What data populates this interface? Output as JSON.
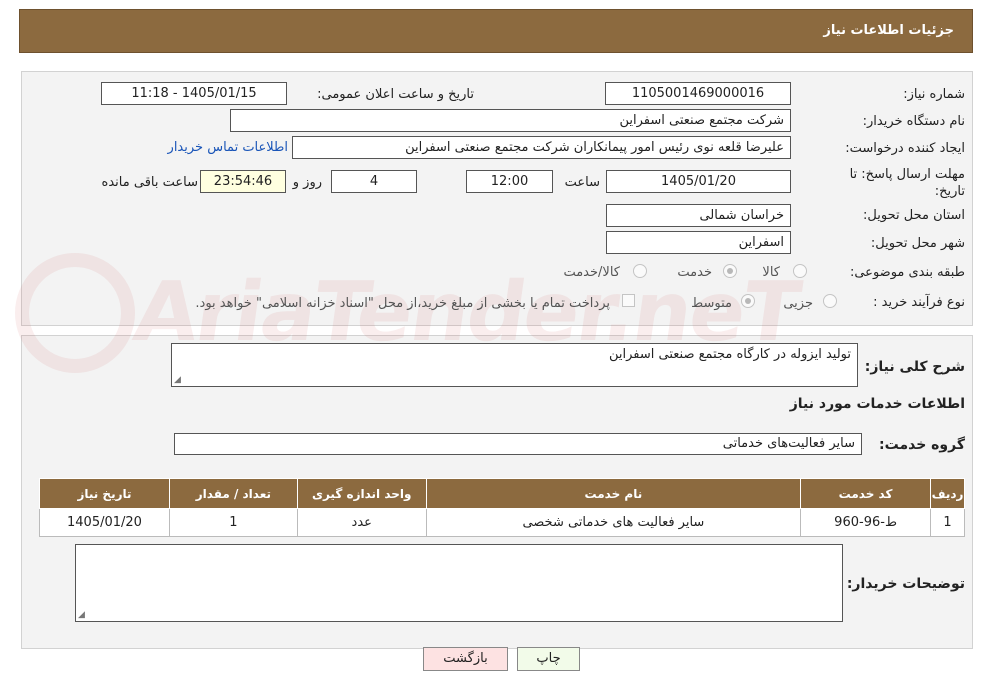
{
  "header": {
    "title": "جزئیات اطلاعات نیاز"
  },
  "form": {
    "need_number_label": "شماره نیاز:",
    "need_number_value": "1105001469000016",
    "announce_datetime_label": "تاریخ و ساعت اعلان عمومی:",
    "announce_datetime_value": "1405/01/15 - 11:18",
    "buyer_org_label": "نام دستگاه خریدار:",
    "buyer_org_value": "شرکت مجتمع صنعتی اسفراین",
    "requester_label": "ایجاد کننده درخواست:",
    "requester_value": "علیرضا قلعه نوی رئیس امور پیمانکاران شرکت مجتمع صنعتی اسفراین",
    "buyer_contact_link": "اطلاعات تماس خریدار",
    "deadline_label": "مهلت ارسال پاسخ: تا تاریخ:",
    "deadline_date": "1405/01/20",
    "time_label": "ساعت",
    "deadline_time": "12:00",
    "days_value": "4",
    "days_label": "روز و",
    "remaining_time": "23:54:46",
    "remaining_label": "ساعت باقی مانده",
    "province_label": "استان محل تحویل:",
    "province_value": "خراسان شمالی",
    "city_label": "شهر محل تحویل:",
    "city_value": "اسفراین",
    "category_label": "طبقه بندی موضوعی:",
    "category_options": [
      "کالا",
      "خدمت",
      "کالا/خدمت"
    ],
    "category_selected": "خدمت",
    "purchase_type_label": "نوع فرآیند خرید :",
    "purchase_options": [
      "جزیی",
      "متوسط"
    ],
    "purchase_selected": "متوسط",
    "treasury_note": "پرداخت تمام یا بخشی از مبلغ خرید،از محل \"اسناد خزانه اسلامی\" خواهد بود."
  },
  "details": {
    "summary_label": "شرح کلی نیاز:",
    "summary_value": "تولید ایزوله در کارگاه مجتمع صنعتی اسفراین",
    "services_heading": "اطلاعات خدمات مورد نیاز",
    "service_group_label": "گروه خدمت:",
    "service_group_value": "سایر فعالیت‌های خدماتی",
    "table": {
      "headers": [
        "ردیف",
        "کد خدمت",
        "نام خدمت",
        "واحد اندازه گیری",
        "تعداد / مقدار",
        "تاریخ نیاز"
      ],
      "rows": [
        [
          "1",
          "ط-96-960",
          "سایر فعالیت های خدماتی شخصی",
          "عدد",
          "1",
          "1405/01/20"
        ]
      ]
    },
    "buyer_notes_label": "توضیحات خریدار:",
    "buyer_notes_value": ""
  },
  "buttons": {
    "print": "چاپ",
    "back": "بازگشت"
  },
  "watermark": {
    "text": "AriaTender.neT"
  },
  "colors": {
    "header_bg": "#8c6a3f",
    "link": "#1a55b8",
    "time_box_bg": "#ffffe0"
  }
}
